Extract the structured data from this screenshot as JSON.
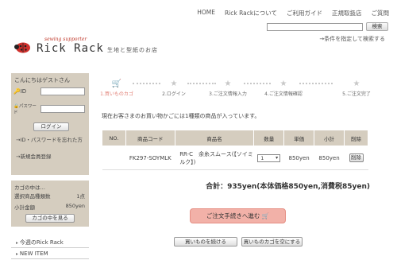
{
  "topnav": [
    "HOME",
    "Rick Rackについて",
    "ご利用ガイド",
    "正規取扱店",
    "ご質問"
  ],
  "search": {
    "button": "検索",
    "advanced": "→条件を指定して検索する"
  },
  "logo": {
    "supporter": "sewing supporter",
    "name": "Rick Rack",
    "tagline": "生地と型紙のお店"
  },
  "login": {
    "greeting": "こんにちはゲストさん",
    "id_label": "ID",
    "password_label": "パスワード",
    "button": "ログイン",
    "forgot": "→ID・パスワードを忘れた方",
    "register": "→新規会員登録"
  },
  "side_cart": {
    "title": "カゴの中は…",
    "selected_label": "選択商品種類数",
    "selected_value": "1点",
    "subtotal_label": "小計金額",
    "subtotal_value": "850yen",
    "button": "カゴの中を見る"
  },
  "side_menu": [
    "今週のRick Rack",
    "NEW ITEM"
  ],
  "steps": [
    "1.買いものカゴ",
    "2.ログイン",
    "3.ご注文情報入力",
    "4.ご注文情報確認",
    "5.ご注文完了"
  ],
  "message": "現在お客さまのお買い物かごには1種類の商品が入っています。",
  "table": {
    "headers": [
      "NO.",
      "商品コード",
      "商品名",
      "数量",
      "単価",
      "小計",
      "削除"
    ],
    "row": {
      "no": "",
      "code": "FK297-SOYMLK",
      "name": "RR-C　余糸スムース(【ソイミルク】)",
      "qty": "1",
      "price": "850yen",
      "subtotal": "850yen",
      "delete": "削除"
    }
  },
  "total": "合計：935yen(本体価格850yen,消費税85yen)",
  "checkout_button": "ご注文手続きへ進む",
  "continue_button": "買いものを続ける",
  "empty_button": "買いものカゴを空にする",
  "colors": {
    "sidebar_bg": "#d5cdbf",
    "accent": "#e07b70",
    "checkout_bg": "#f2b1a8"
  }
}
